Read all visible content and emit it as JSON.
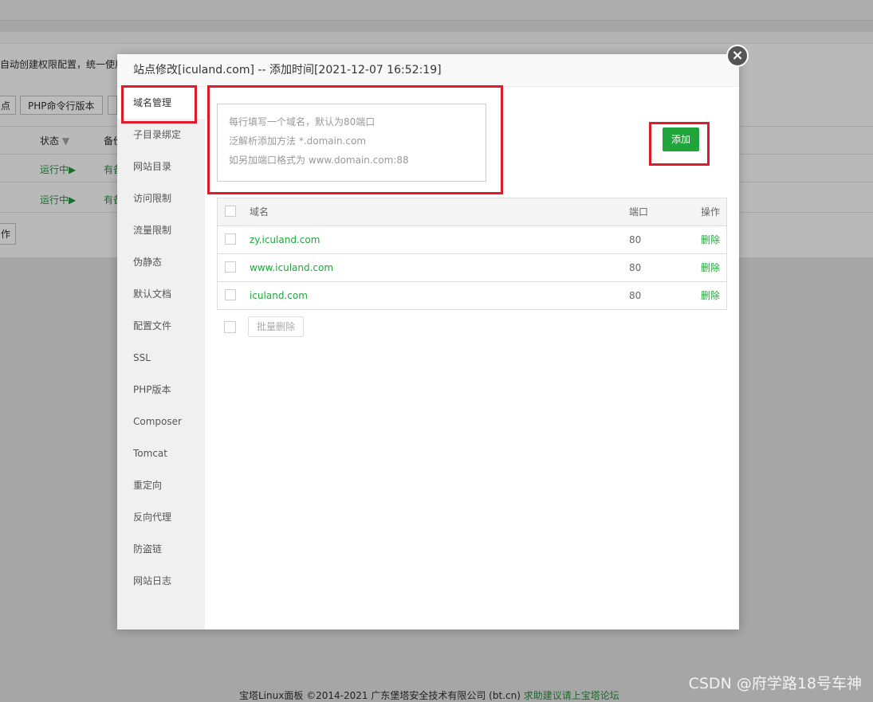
{
  "background": {
    "notice": "自动创建权限配置，统一使用",
    "buttons": [
      "点",
      "PHP命令行版本"
    ],
    "table_head": {
      "status": "状态",
      "status_arrow": "▼",
      "backup": "备份"
    },
    "rows": [
      {
        "status": "运行中▶",
        "backup": "有备"
      },
      {
        "status": "运行中▶",
        "backup": "有备"
      }
    ],
    "batch_button": "作",
    "footer": {
      "copyright": "宝塔Linux面板 ©2014-2021 广东堡塔安全技术有限公司 (bt.cn)",
      "link": "求助建议请上宝塔论坛"
    },
    "watermark": "CSDN @府学路18号车神"
  },
  "modal": {
    "title": "站点修改[iculand.com] -- 添加时间[2021-12-07 16:52:19]",
    "close_icon": "×",
    "sidebar": [
      {
        "label": "域名管理",
        "active": true
      },
      {
        "label": "子目录绑定"
      },
      {
        "label": "网站目录"
      },
      {
        "label": "访问限制"
      },
      {
        "label": "流量限制"
      },
      {
        "label": "伪静态"
      },
      {
        "label": "默认文档"
      },
      {
        "label": "配置文件"
      },
      {
        "label": "SSL"
      },
      {
        "label": "PHP版本"
      },
      {
        "label": "Composer"
      },
      {
        "label": "Tomcat"
      },
      {
        "label": "重定向"
      },
      {
        "label": "反向代理"
      },
      {
        "label": "防盗链"
      },
      {
        "label": "网站日志"
      }
    ],
    "domain_input": {
      "placeholder_lines": [
        "每行填写一个域名，默认为80端口",
        "泛解析添加方法 *.domain.com",
        "如另加端口格式为 www.domain.com:88"
      ],
      "value": ""
    },
    "add_button": "添加",
    "table": {
      "headers": {
        "name": "域名",
        "port": "端口",
        "op": "操作"
      },
      "rows": [
        {
          "domain": "zy.iculand.com",
          "port": "80",
          "op": "删除"
        },
        {
          "domain": "www.iculand.com",
          "port": "80",
          "op": "删除"
        },
        {
          "domain": "iculand.com",
          "port": "80",
          "op": "删除"
        }
      ]
    },
    "batch_delete": "批量删除"
  },
  "colors": {
    "accent": "#20a53a",
    "highlight": "#e0192b"
  }
}
